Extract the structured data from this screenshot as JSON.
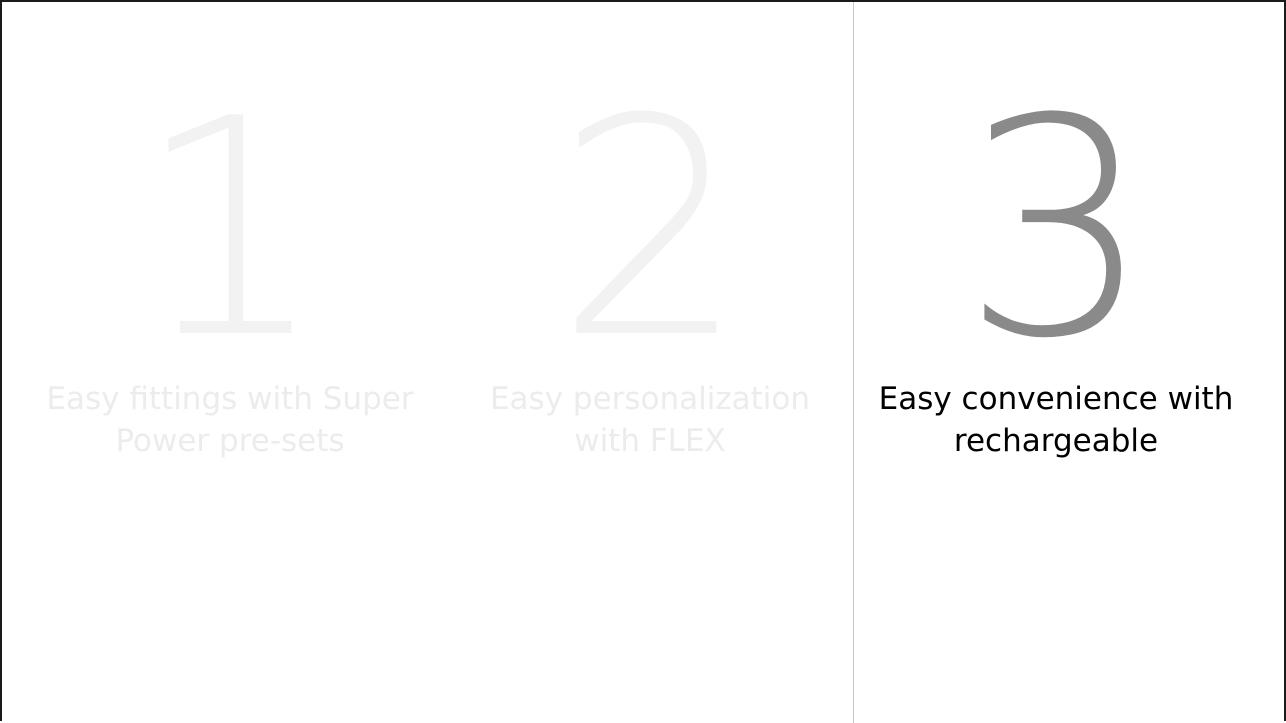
{
  "steps": [
    {
      "number": "1",
      "caption_line1": "Easy fittings with Super",
      "caption_line2": "Power pre-sets",
      "state": "inactive"
    },
    {
      "number": "2",
      "caption_line1": "Easy personalization",
      "caption_line2": "with FLEX",
      "state": "inactive"
    },
    {
      "number": "3",
      "caption_line1": "Easy convenience with",
      "caption_line2": "rechargeable",
      "state": "active"
    }
  ],
  "colors": {
    "inactive_number": "#f2f2f2",
    "inactive_caption": "#ececec",
    "active_number": "#8a8a8a",
    "active_caption": "#000000",
    "frame": "#1a1a1a",
    "divider": "#c8c8c8"
  }
}
